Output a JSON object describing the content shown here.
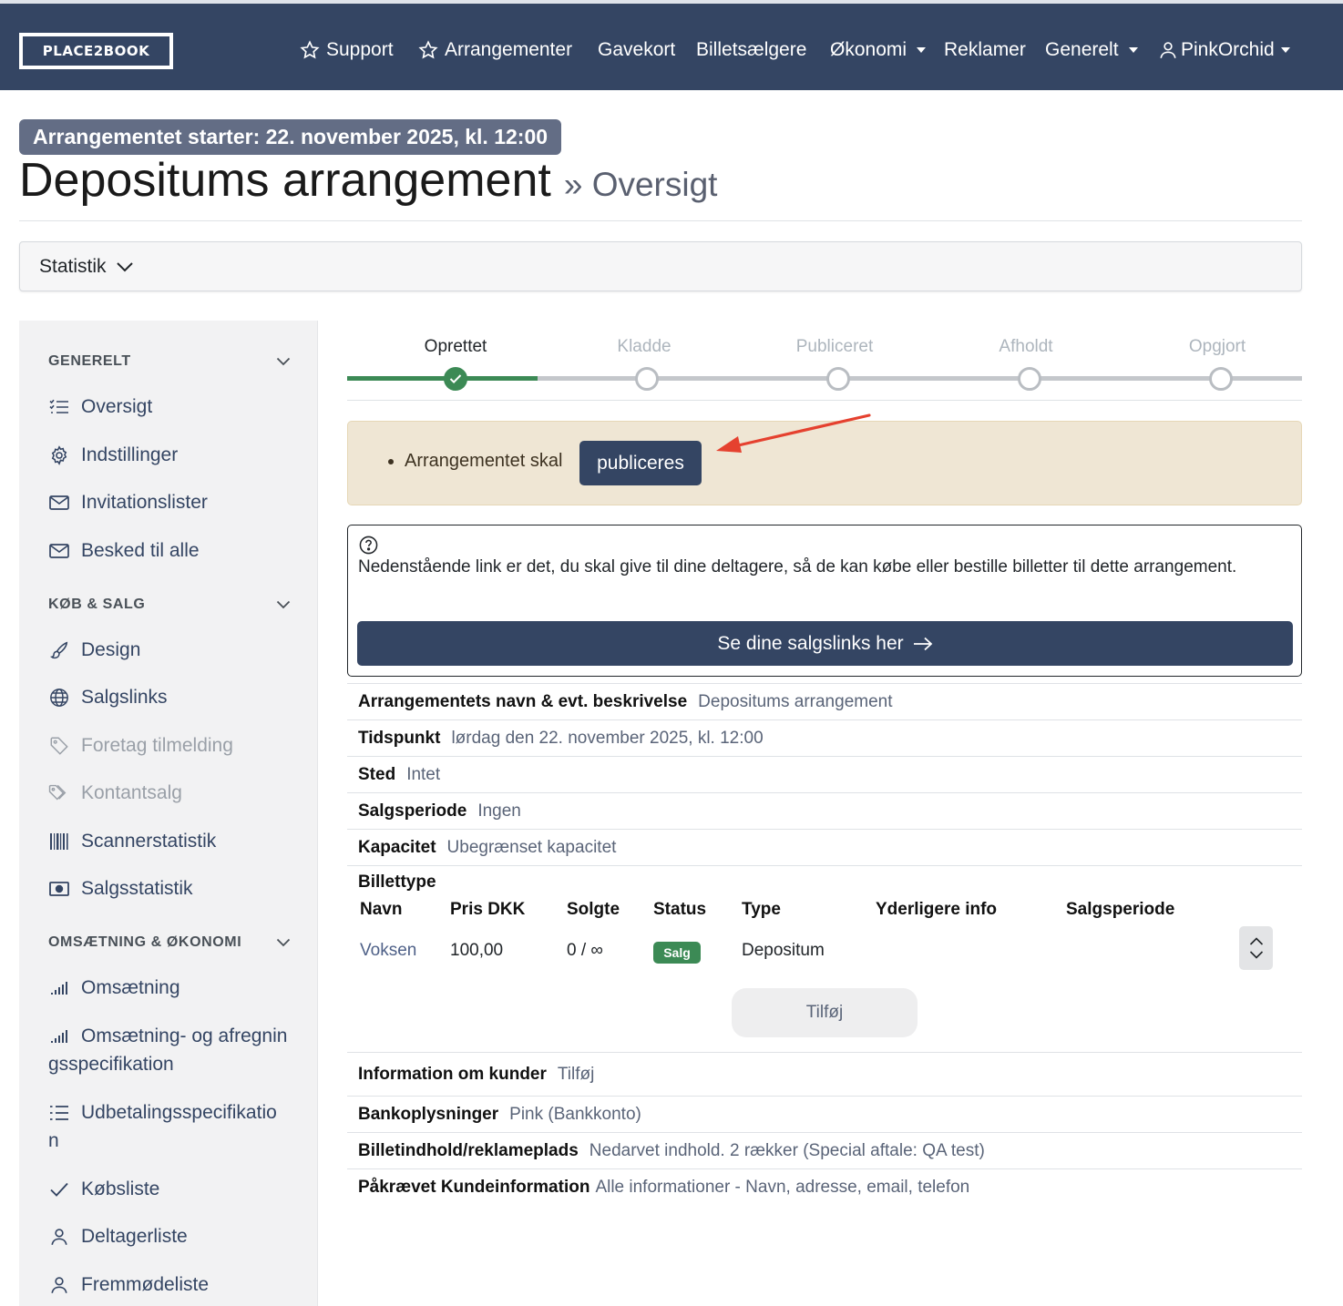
{
  "brand": {
    "logo_text": "PLACE2BOOK"
  },
  "nav": {
    "support": "Support",
    "arrangementer": "Arrangementer",
    "gavekort": "Gavekort",
    "billetsaelgere": "Billetsælgere",
    "okonomi": "Økonomi",
    "reklamer": "Reklamer",
    "generelt": "Generelt",
    "user": "PinkOrchid"
  },
  "header": {
    "start_badge": "Arrangementet starter: 22. november 2025, kl. 12:00",
    "title": "Depositums arrangement",
    "subtitle": "» Oversigt"
  },
  "stat_bar": {
    "label": "Statistik"
  },
  "sidebar": {
    "sections": [
      {
        "title": "GENERELT"
      },
      {
        "title": "KØB & SALG"
      },
      {
        "title": "OMSÆTNING & ØKONOMI"
      }
    ],
    "items": [
      {
        "label": "Oversigt",
        "icon": "list-check-icon"
      },
      {
        "label": "Indstillinger",
        "icon": "gear-icon"
      },
      {
        "label": "Invitationslister",
        "icon": "envelope-icon"
      },
      {
        "label": "Besked til alle",
        "icon": "envelope-icon"
      },
      {
        "label": "Design",
        "icon": "brush-icon"
      },
      {
        "label": "Salgslinks",
        "icon": "globe-icon"
      },
      {
        "label": "Foretag tilmelding",
        "icon": "tag-icon",
        "disabled": true
      },
      {
        "label": "Kontantsalg",
        "icon": "tags-icon",
        "disabled": true
      },
      {
        "label": "Scannerstatistik",
        "icon": "barcode-icon"
      },
      {
        "label": "Salgsstatistik",
        "icon": "cash-icon"
      },
      {
        "label": "Omsætning",
        "icon": "signal-icon"
      },
      {
        "label": "Omsætning- og afregningsspecifikation",
        "icon": "signal-icon"
      },
      {
        "label": "Udbetalingsspecifikation",
        "icon": "list-icon"
      },
      {
        "label": "Købsliste",
        "icon": "check-icon"
      },
      {
        "label": "Deltagerliste",
        "icon": "person-icon"
      },
      {
        "label": "Fremmødeliste",
        "icon": "person-icon"
      }
    ]
  },
  "stepper": {
    "steps": [
      {
        "label": "Oprettet",
        "state": "done"
      },
      {
        "label": "Kladde",
        "state": "pending"
      },
      {
        "label": "Publiceret",
        "state": "pending"
      },
      {
        "label": "Afholdt",
        "state": "pending"
      },
      {
        "label": "Opgjort",
        "state": "pending"
      }
    ],
    "done_color": "#3c8a55",
    "pending_color": "#c4c7cb"
  },
  "notice": {
    "text": "Arrangementet skal",
    "button": "publiceres"
  },
  "links_box": {
    "text": "Nedenstående link er det, du skal give til dine deltagere, så de kan købe eller bestille billetter til dette arrangement.",
    "button": "Se dine salgslinks her"
  },
  "details": [
    {
      "key": "Arrangementets navn & evt. beskrivelse",
      "value": "Depositums arrangement"
    },
    {
      "key": "Tidspunkt",
      "value": "lørdag den 22. november 2025, kl. 12:00"
    },
    {
      "key": "Sted",
      "value": "Intet"
    },
    {
      "key": "Salgsperiode",
      "value": "Ingen"
    },
    {
      "key": "Kapacitet",
      "value": "Ubegrænset kapacitet"
    }
  ],
  "tickets": {
    "title": "Billettype",
    "headers": [
      "Navn",
      "Pris DKK",
      "Solgte",
      "Status",
      "Type",
      "Yderligere info",
      "Salgsperiode"
    ],
    "rows": [
      {
        "navn": "Voksen",
        "pris": "100,00",
        "solgte": "0 / ∞",
        "status": "Salg",
        "type": "Depositum"
      }
    ],
    "add_button": "Tilføj"
  },
  "details2": [
    {
      "key": "Information om kunder",
      "value": "Tilføj"
    },
    {
      "key": "Bankoplysninger",
      "value": "Pink (Bankkonto)"
    },
    {
      "key": "Billetindhold/reklameplads",
      "value": "Nedarvet indhold. 2 rækker (Special aftale: QA test)"
    },
    {
      "key": "Påkrævet Kundeinformation",
      "value": "Alle informationer - Navn, adresse, email, telefon"
    }
  ],
  "colors": {
    "navbar": "#344563",
    "primary_button": "#344563",
    "success": "#3c8a55",
    "warning_bg": "#efe6d4",
    "arrow": "#e5412f"
  }
}
